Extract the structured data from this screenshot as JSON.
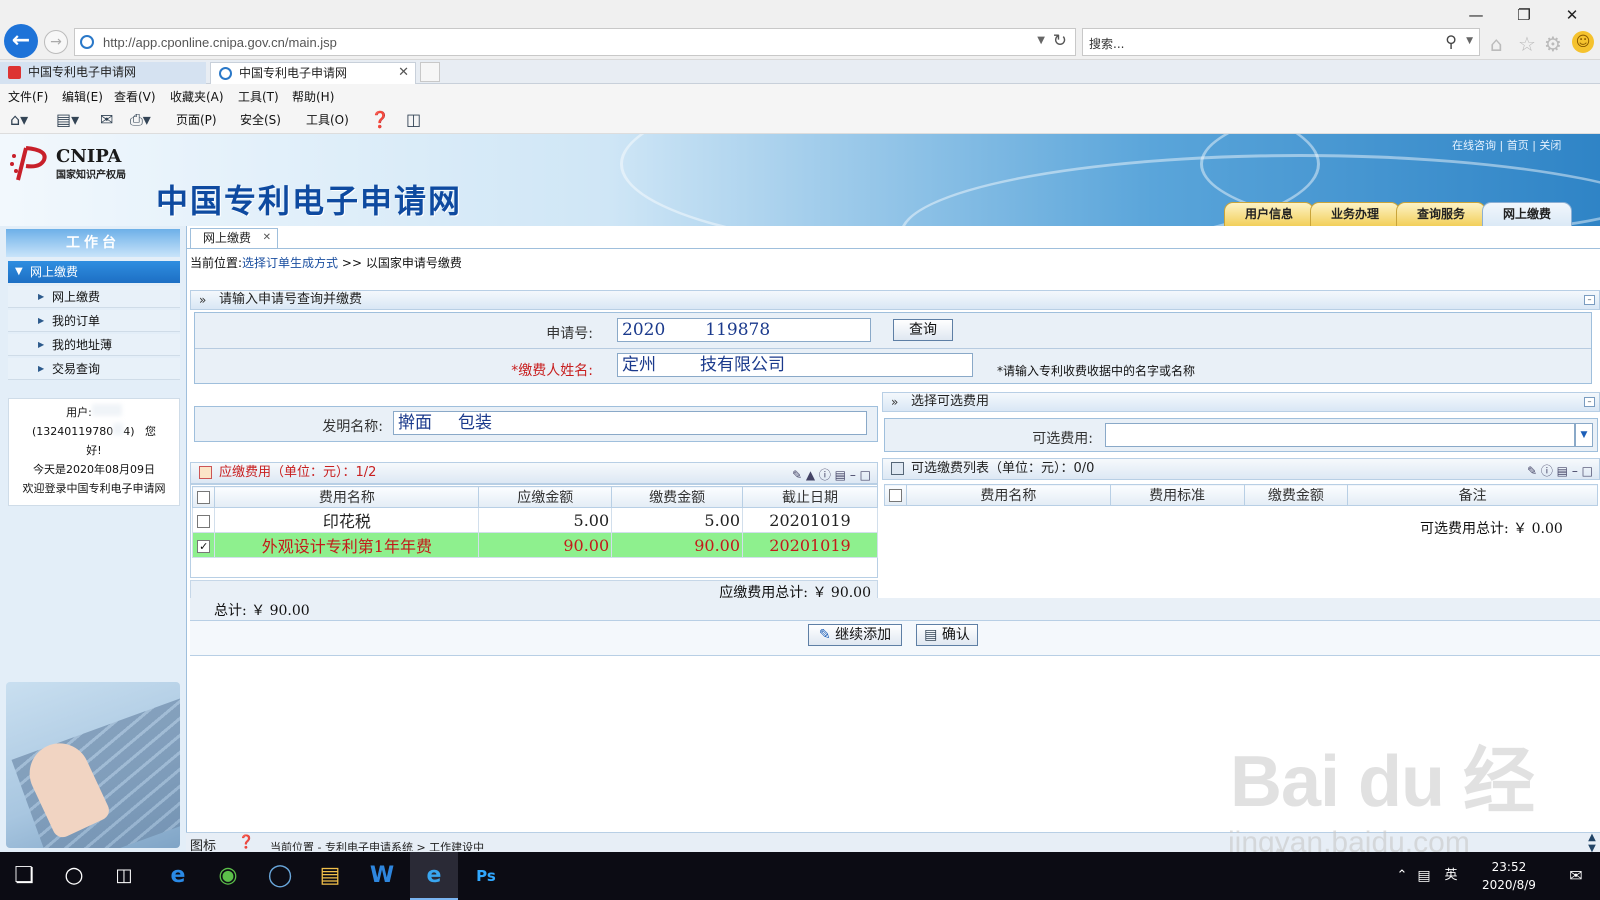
{
  "browser": {
    "url": "http://app.cponline.cnipa.gov.cn/main.jsp",
    "search_placeholder": "搜索...",
    "tabs": [
      {
        "label": "中国专利电子申请网"
      },
      {
        "label": "中国专利电子申请网"
      }
    ],
    "menu": [
      "文件(F)",
      "编辑(E)",
      "查看(V)",
      "收藏夹(A)",
      "工具(T)",
      "帮助(H)"
    ],
    "command_bar": {
      "page": "页面(P)",
      "safety": "安全(S)",
      "tools": "工具(O)"
    }
  },
  "site": {
    "logo_en": "CNIPA",
    "logo_cn": "国家知识产权局",
    "title": "中国专利电子申请网",
    "top_links": "在线咨询 | 首页 | 关闭",
    "nav_tabs": [
      "用户信息",
      "业务办理",
      "查询服务",
      "网上缴费"
    ],
    "active_nav": "网上缴费"
  },
  "sidebar": {
    "header": "工作台",
    "section": "网上缴费",
    "items": [
      "网上缴费",
      "我的订单",
      "我的地址薄",
      "交易查询"
    ],
    "user_lines": [
      "用户:",
      "(13240119780",
      "4)",
      "您",
      "好!",
      "今天是2020年08月09日",
      "欢迎登录中国专利电子申请网"
    ]
  },
  "main": {
    "tab_label": "网上缴费",
    "breadcrumb": {
      "prefix": "当前位置:",
      "link": "选择订单生成方式",
      "sep": ">>",
      "current": "以国家申请号缴费"
    },
    "query_section": {
      "title": "请输入申请号查询并缴费",
      "app_no_label": "申请号:",
      "app_no_value": "2020",
      "app_no_value_tail": "119878",
      "query_button": "查询",
      "payer_label": "*缴费人姓名:",
      "payer_value": "定州",
      "payer_value_tail": "技有限公司",
      "payer_hint": "*请输入专利收费收据中的名字或名称",
      "invention_label": "发明名称:",
      "invention_value": "擀面",
      "invention_value_tail": "包装"
    },
    "optional_section": {
      "title": "选择可选费用",
      "label": "可选费用:",
      "value": ""
    },
    "due_fees": {
      "title": "应缴费用（单位：元）：1/2",
      "columns": [
        "费用名称",
        "应缴金额",
        "缴费金额",
        "截止日期"
      ],
      "rows": [
        {
          "name": "印花税",
          "due": "5.00",
          "paid": "5.00",
          "deadline": "20201019",
          "checked": false
        },
        {
          "name": "外观设计专利第1年年费",
          "due": "90.00",
          "paid": "90.00",
          "deadline": "20201019",
          "checked": true
        }
      ],
      "total": "应缴费用总计: ￥ 90.00"
    },
    "optional_list": {
      "title": "可选缴费列表（单位：元）：0/0",
      "columns": [
        "费用名称",
        "费用标准",
        "缴费金额",
        "备注"
      ],
      "total": "可选费用总计: ￥ 0.00"
    },
    "grand_total": "总计: ￥ 90.00",
    "buttons": {
      "add_more": "继续添加",
      "confirm": "确认"
    },
    "status": {
      "icons_label": "图标",
      "location": "当前位置 - 专利电子申请系统 > 工作建设中"
    }
  },
  "watermark": {
    "main": "Bai du 经验",
    "sub": "jingyan.baidu.com"
  },
  "taskbar": {
    "ime": "英",
    "time": "23:52",
    "date": "2020/8/9"
  },
  "colors": {
    "brand_blue": "#0e4aa0",
    "selected_row": "#8ef08e",
    "due_title": "#c81f1f"
  }
}
